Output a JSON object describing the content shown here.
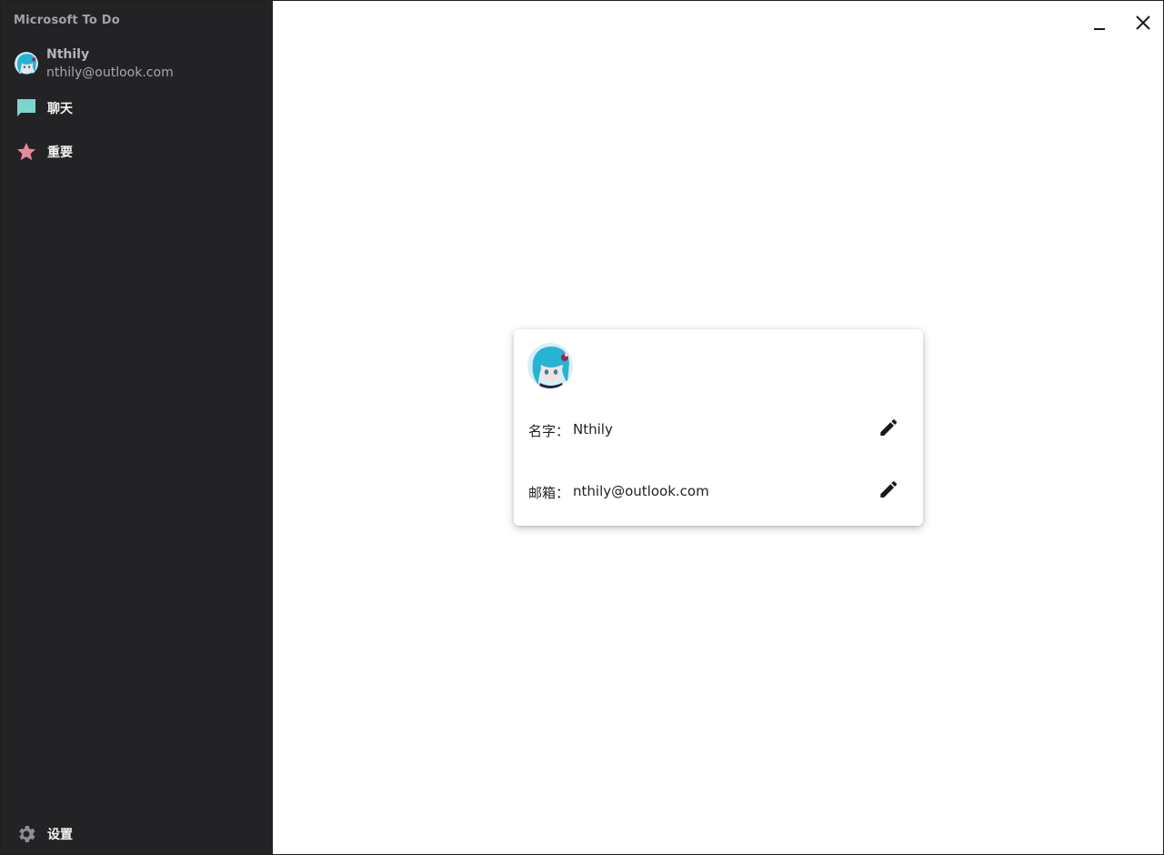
{
  "app": {
    "title": "Microsoft To Do"
  },
  "profile": {
    "name": "Nthily",
    "email": "nthily@outlook.com"
  },
  "nav": {
    "chat_label": "聊天",
    "important_label": "重要",
    "settings_label": "设置"
  },
  "card": {
    "name_label": "名字：",
    "name_value": "Nthily",
    "email_label": "邮箱：",
    "email_value": "nthily@outlook.com"
  },
  "colors": {
    "sidebar_bg": "#232326",
    "chat_icon": "#7fd3cf",
    "star_icon": "#e78a9c",
    "gear_icon": "#8e8e92"
  },
  "icons": {
    "chat": "chat-bubble-icon",
    "important": "star-icon",
    "settings": "gear-icon",
    "edit": "pencil-icon",
    "minimize": "minimize-icon",
    "close": "close-icon"
  }
}
